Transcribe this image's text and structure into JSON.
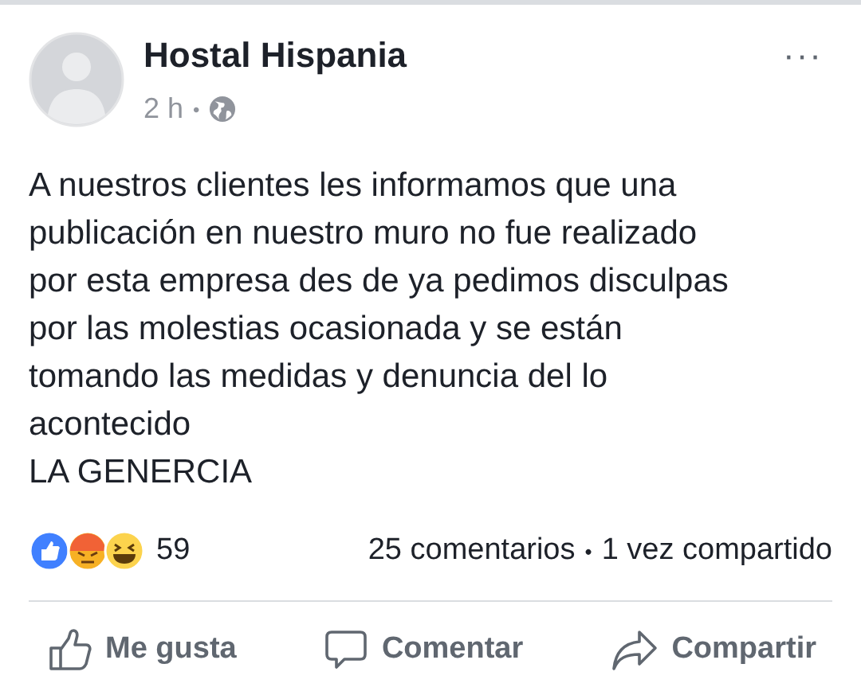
{
  "post": {
    "author": "Hostal Hispania",
    "time": "2 h",
    "separator": "•",
    "menu": "···",
    "body": "A nuestros clientes les informamos que una\npublicación en nuestro muro no fue realizado\npor esta empresa des de ya pedimos disculpas\npor las molestias ocasionada y se están\ntomando las medidas y denuncia del lo\nacontecido\nLA GENERCIA"
  },
  "reactions": {
    "count": "59",
    "comments": "25 comentarios",
    "dot": "•",
    "shares": "1 vez compartido"
  },
  "actions": [
    {
      "kind": "like",
      "label": "Me gusta"
    },
    {
      "kind": "comment",
      "label": "Comentar"
    },
    {
      "kind": "share",
      "label": "Compartir"
    }
  ]
}
